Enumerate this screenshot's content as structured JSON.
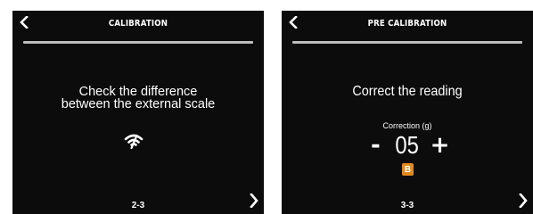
{
  "colors": {
    "screen_bg": "#0c0c0c",
    "text": "#ffffff",
    "divider": "#bdbdbd",
    "accent": "#e08a1e"
  },
  "screen_left": {
    "back_icon": "chevron-left-icon",
    "title": "CALIBRATION",
    "message_line1": "Check the difference",
    "message_line2": "between the external scale",
    "status_icon": "wifi-icon",
    "page": "2-3",
    "forward_icon": "chevron-right-icon"
  },
  "screen_right": {
    "back_icon": "chevron-left-icon",
    "title": "PRE CALIBRATION",
    "heading": "Correct the reading",
    "correction_label": "Correction (g)",
    "minus": "-",
    "value": "05",
    "plus": "+",
    "badge": "B",
    "page": "3-3",
    "forward_icon": "chevron-right-icon"
  }
}
